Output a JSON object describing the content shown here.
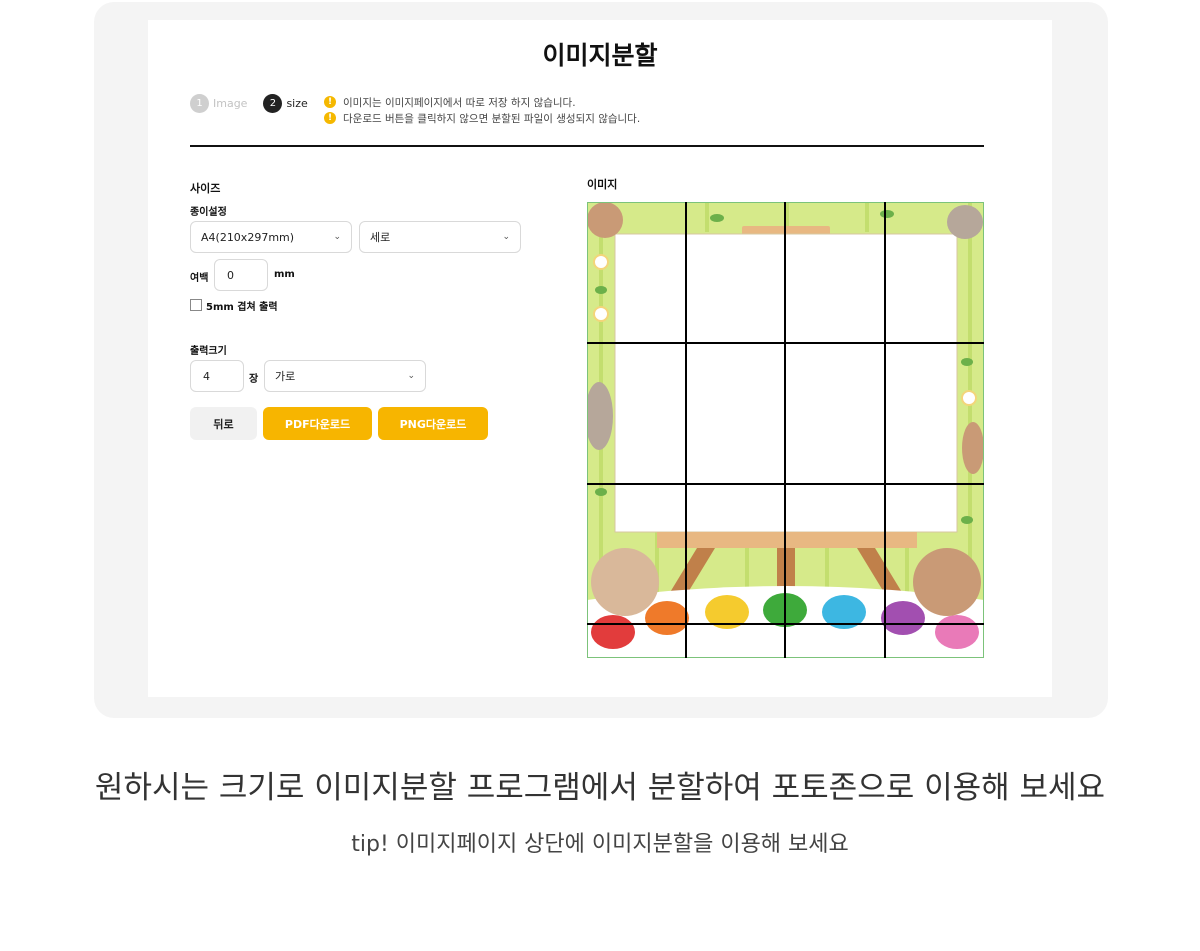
{
  "header": {
    "title": "이미지분할"
  },
  "steps": [
    {
      "num": "1",
      "label": "Image"
    },
    {
      "num": "2",
      "label": "size"
    }
  ],
  "notices": [
    "이미지는 이미지페이지에서 따로 저장 하지 않습니다.",
    "다운로드 버튼을 클릭하지 않으면 분할된 파일이 생성되지 않습니다."
  ],
  "warn_icon": "exclamation-icon",
  "size_section": {
    "title": "사이즈",
    "paper_label": "종이설정",
    "paper_size": "A4(210x297mm)",
    "orientation": "세로",
    "margin_label": "여백",
    "margin_value": "0",
    "margin_unit": "mm",
    "overlap_label": "5mm 겹쳐 출력",
    "overlap_checked": false
  },
  "output_section": {
    "title": "출력크기",
    "count": "4",
    "count_unit": "장",
    "direction": "가로"
  },
  "buttons": {
    "back": "뒤로",
    "pdf": "PDF다운로드",
    "png": "PNG다운로드"
  },
  "preview": {
    "label": "이미지",
    "grid_columns": 4,
    "grid_rows": 4
  },
  "footer": {
    "headline": "원하시는 크기로 이미지분할 프로그램에서 분할하여 포토존으로 이용해 보세요",
    "tip": "tip! 이미지페이지 상단에 이미지분할을 이용해 보세요"
  },
  "colors": {
    "accent": "#f7b500",
    "background_green": "#d6ea8a",
    "frame_gray": "#f4f4f4"
  }
}
